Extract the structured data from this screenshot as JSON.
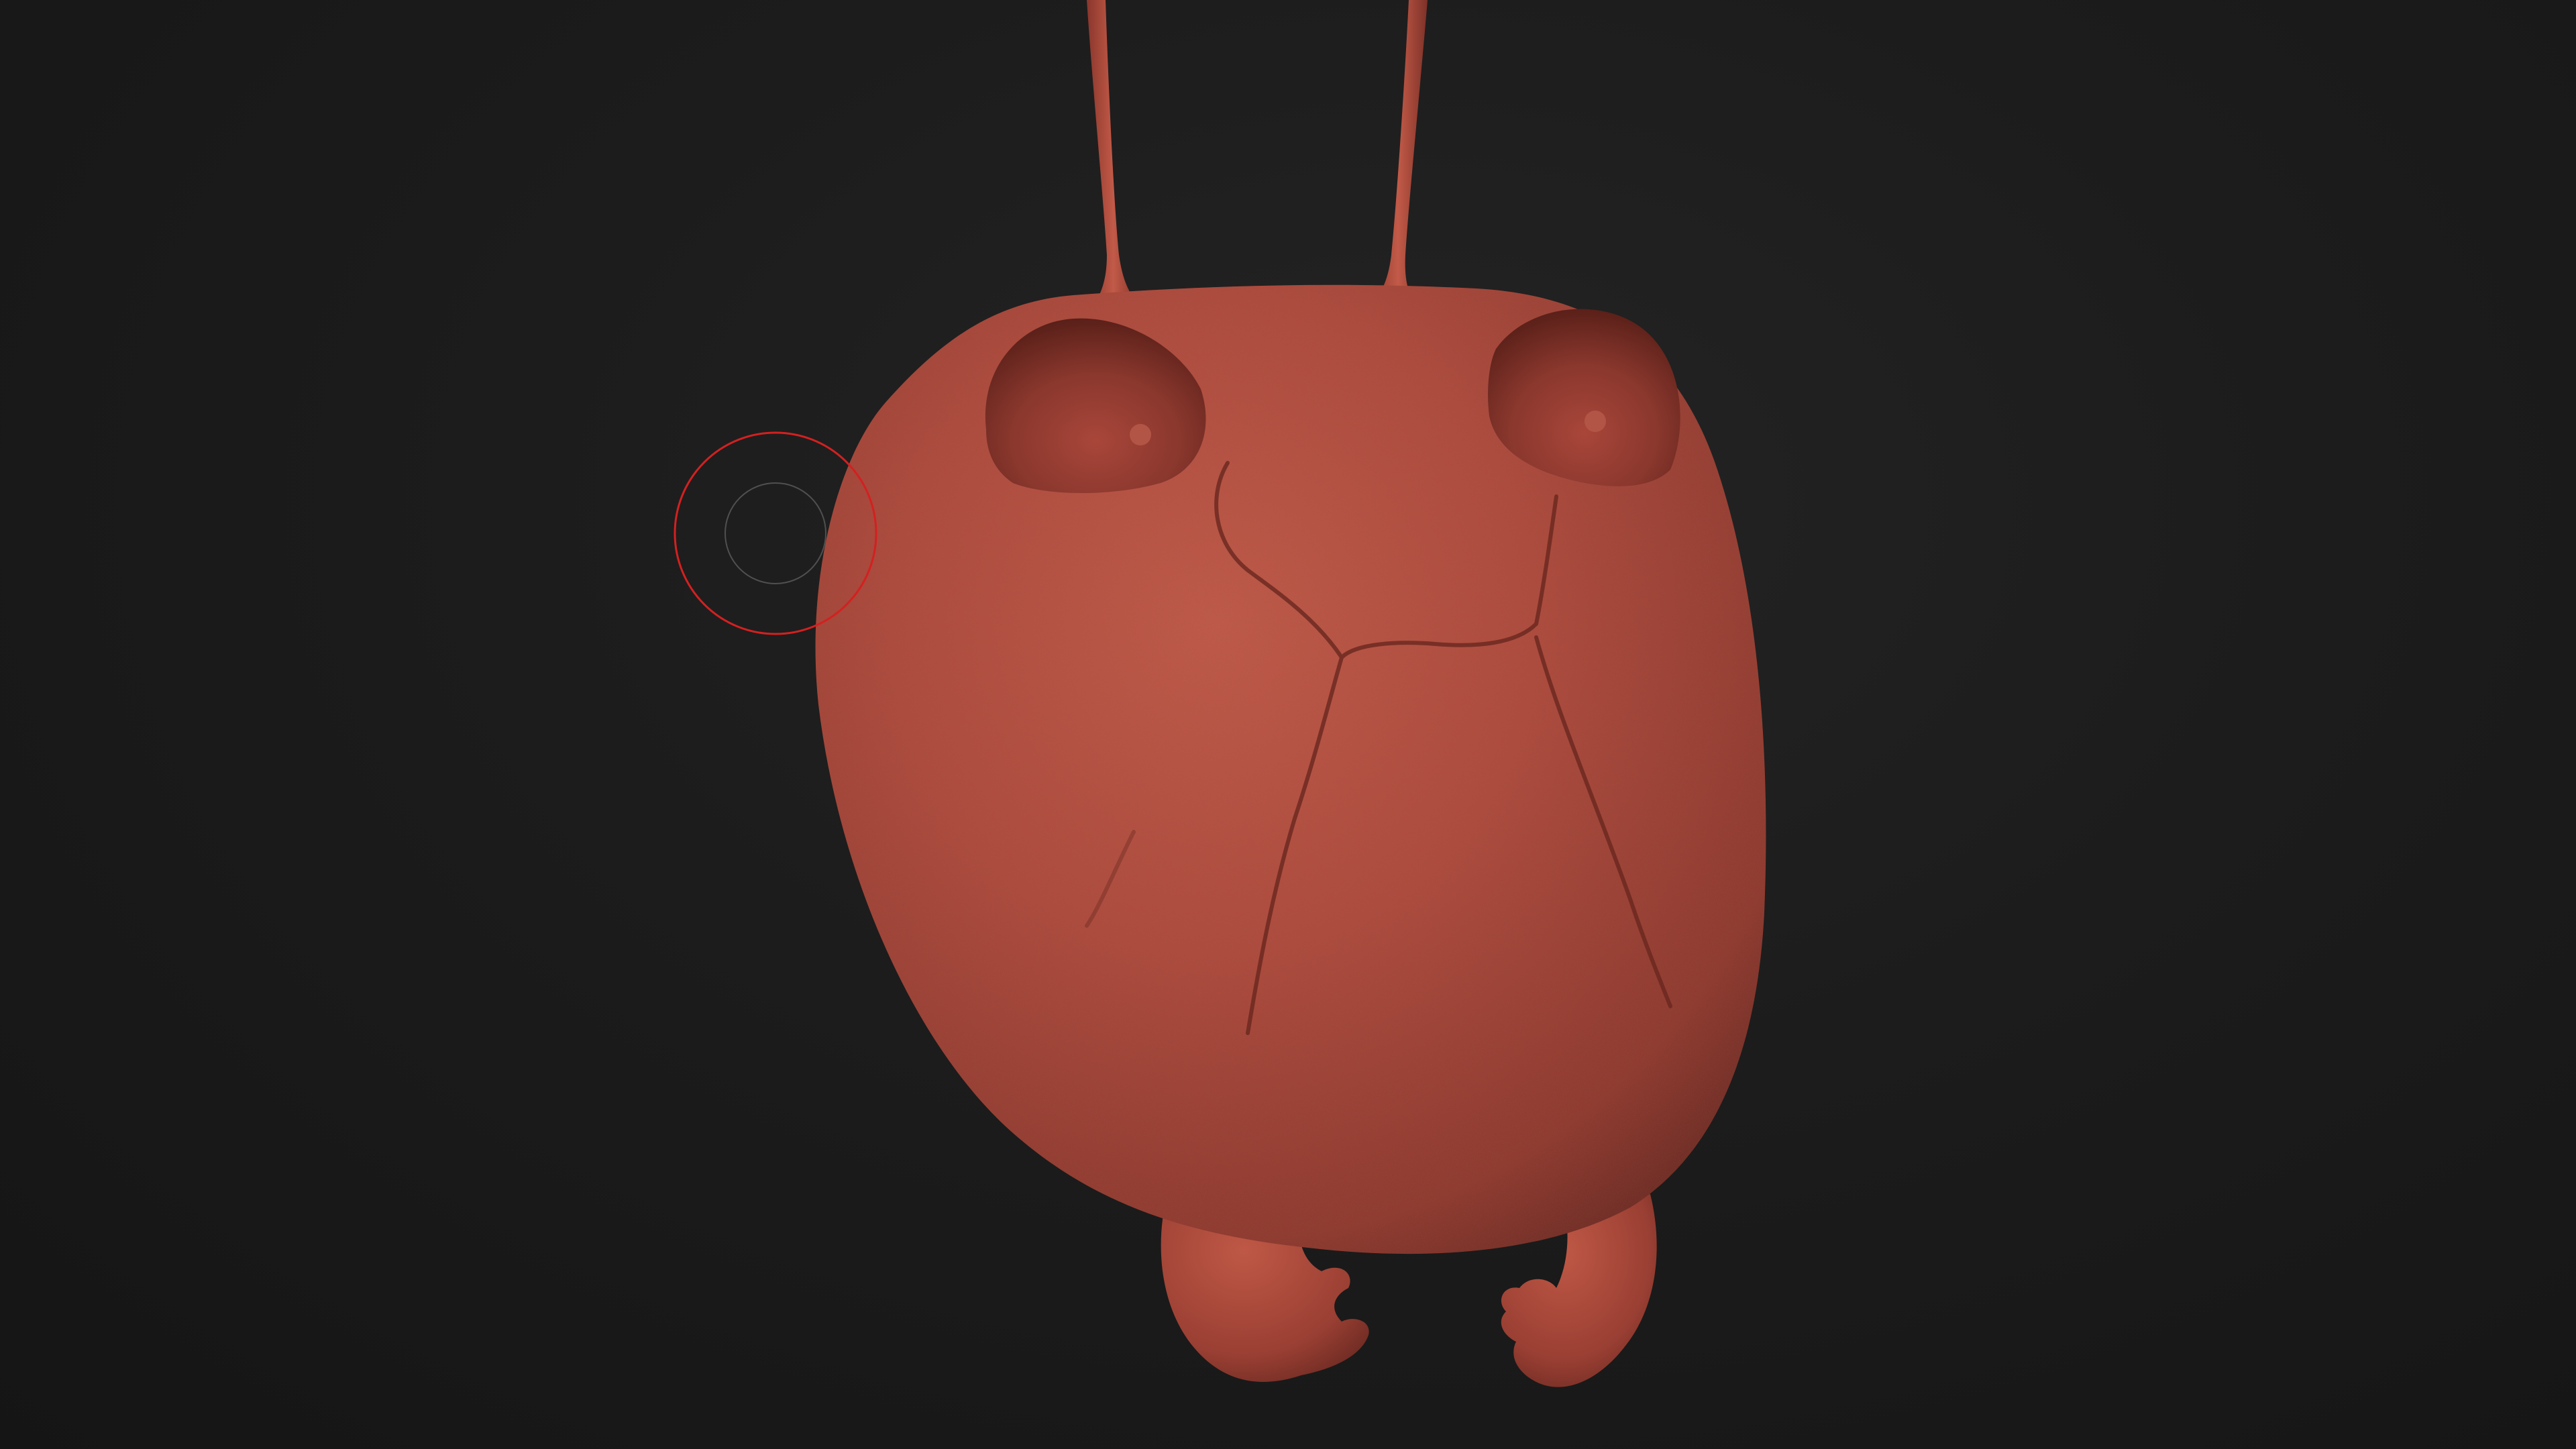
{
  "viewport": {
    "background_color": "#1a1a1a",
    "material_color": "#b04a3c",
    "cursor_color": "#d42020"
  },
  "model": {
    "parts": [
      "antenna-left",
      "antenna-right",
      "head-shell",
      "eye-left",
      "eye-right",
      "shell-crack",
      "leg-left",
      "leg-right"
    ]
  },
  "brush_cursor": {
    "icon": "brush-cursor-icon"
  }
}
